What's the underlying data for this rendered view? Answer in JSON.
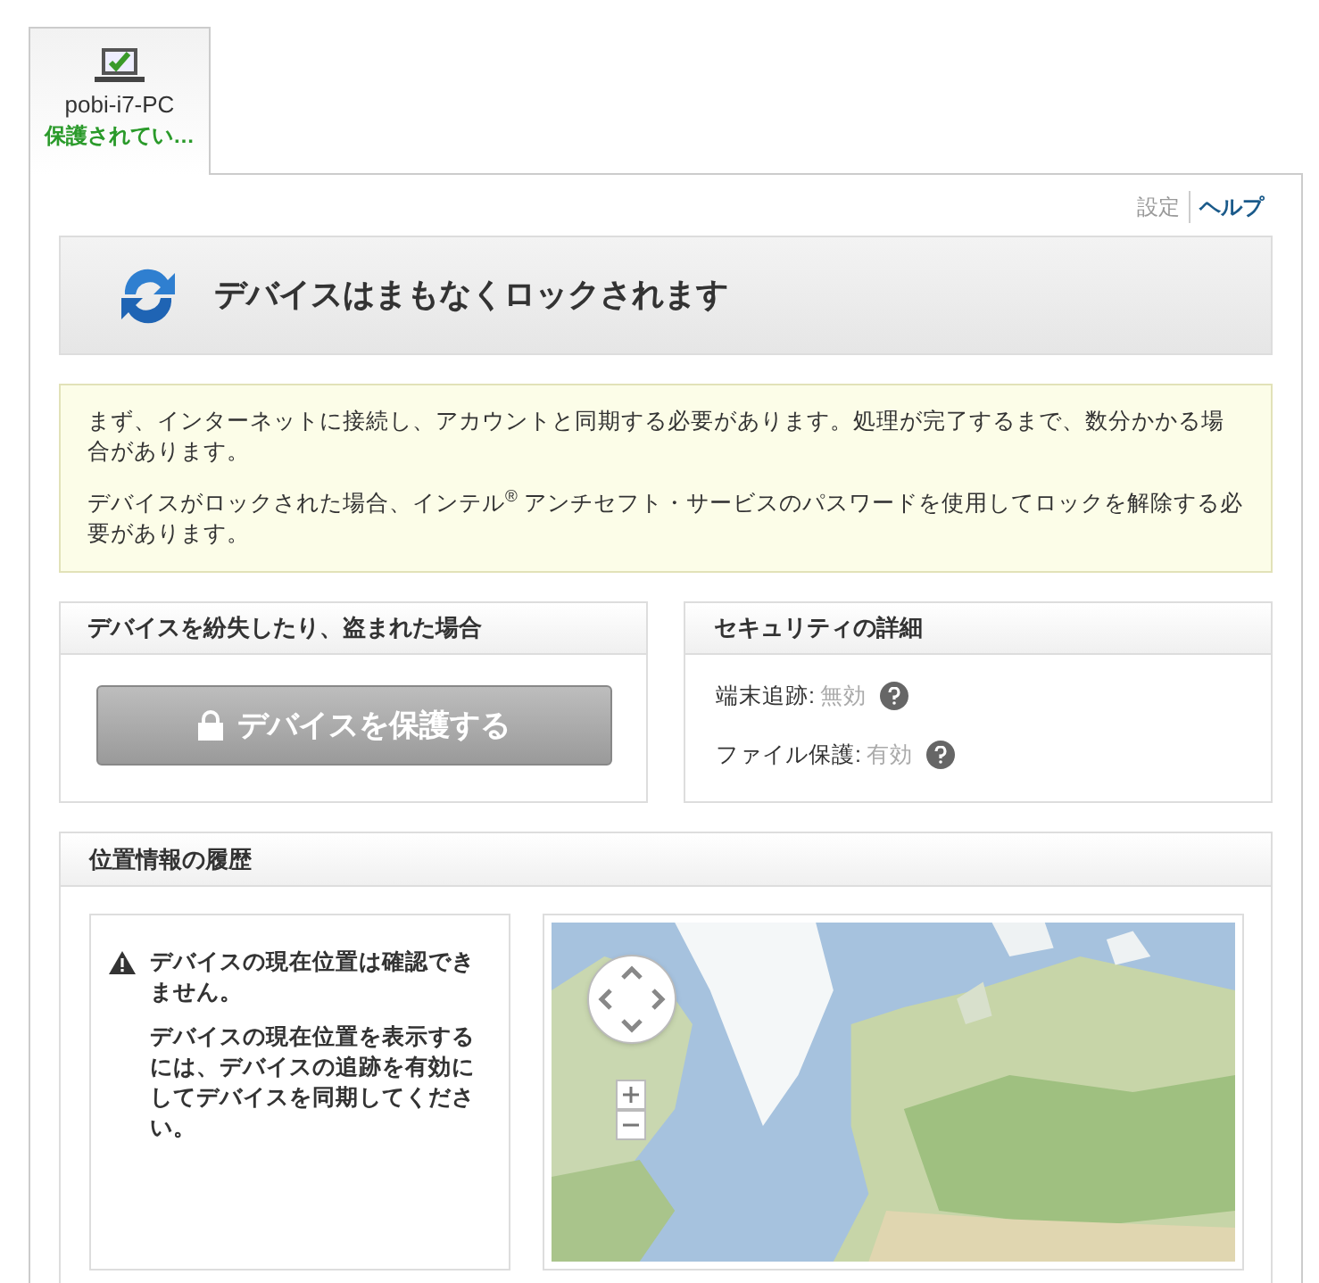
{
  "device_tab": {
    "name": "pobi-i7-PC",
    "status": "保護されてい…",
    "selected": true
  },
  "links": [
    {
      "label": "設定",
      "kind": "muted"
    },
    {
      "label": "ヘルプ",
      "kind": "strong"
    }
  ],
  "banner": {
    "title": "デバイスはまもなくロックされます"
  },
  "notice": {
    "paragraphs": [
      "まず、インターネットに接続し、アカウントと同期する必要があります。処理が完了するまで、数分かかる場合があります。",
      "デバイスがロックされた場合、インテル$^{®}$ アンチセフト・サービスのパスワードを使用してロックを解除する必要があります。"
    ]
  },
  "lost_panel": {
    "title": "デバイスを紛失したり、盗まれた場合",
    "button": {
      "label": "デバイスを保護する",
      "disabled": true
    }
  },
  "security_panel": {
    "title": "セキュリティの詳細",
    "items": [
      {
        "label": "端末追跡:",
        "value": "無効"
      },
      {
        "label": "ファイル保護:",
        "value": "有効"
      }
    ]
  },
  "location_panel": {
    "title": "位置情報の履歴",
    "warning": "デバイスの現在位置は確認できません。",
    "hint": "デバイスの現在位置を表示するには、デバイスの追跡を有効にしてデバイスを同期してください。"
  }
}
